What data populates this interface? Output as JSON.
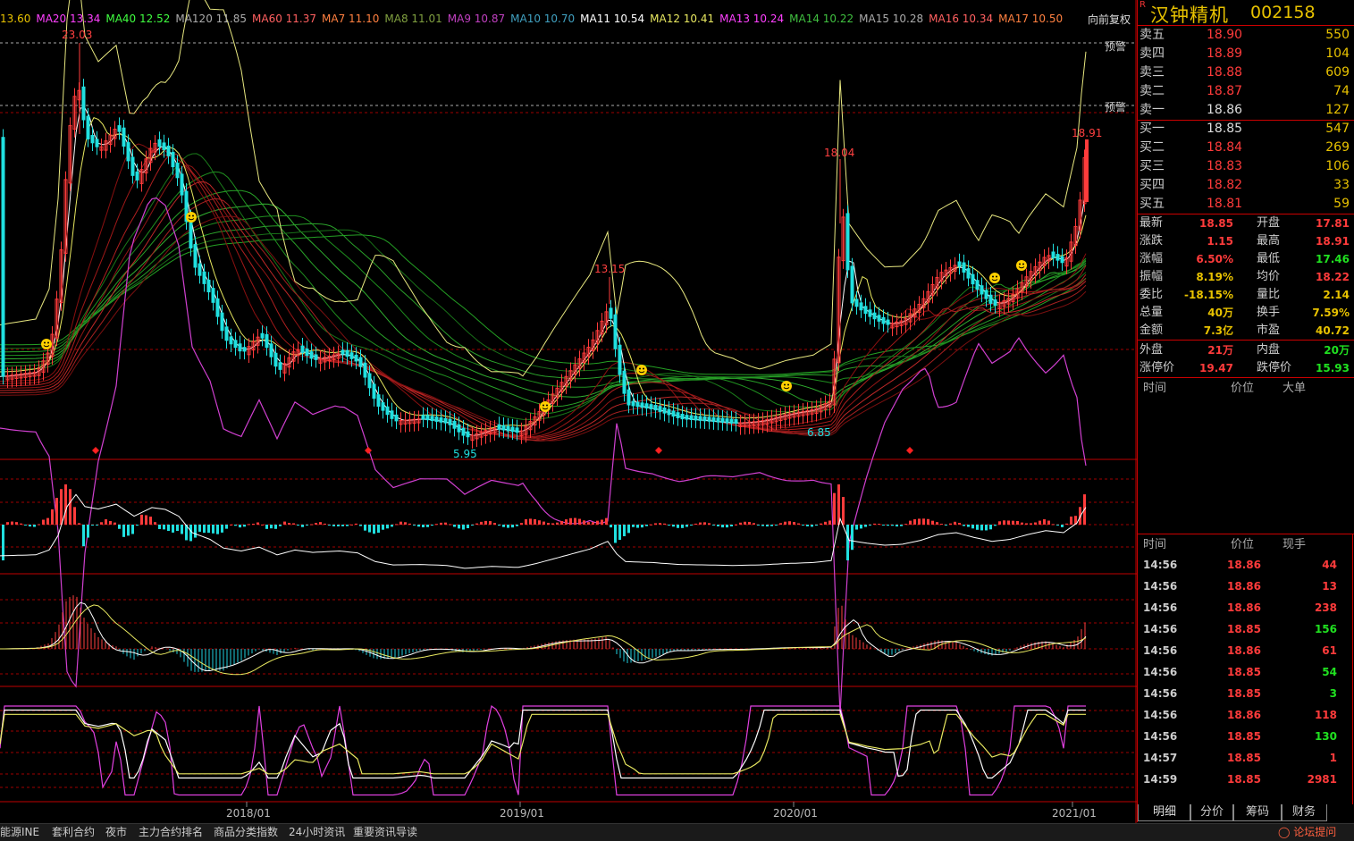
{
  "ma_legend": [
    {
      "label": "",
      "value": "13.60",
      "color": "#e8c200"
    },
    {
      "label": "MA20",
      "value": "13.34",
      "color": "#ff40ff"
    },
    {
      "label": "MA40",
      "value": "12.52",
      "color": "#40ff40"
    },
    {
      "label": "MA120",
      "value": "11.85",
      "color": "#aaaaaa"
    },
    {
      "label": "MA60",
      "value": "11.37",
      "color": "#ff6060"
    },
    {
      "label": "MA7",
      "value": "11.10",
      "color": "#ff8040"
    },
    {
      "label": "MA8",
      "value": "11.01",
      "color": "#80a040"
    },
    {
      "label": "MA9",
      "value": "10.87",
      "color": "#c040c0"
    },
    {
      "label": "MA10",
      "value": "10.70",
      "color": "#40a0c0"
    },
    {
      "label": "MA11",
      "value": "10.54",
      "color": "#ffffff"
    },
    {
      "label": "MA12",
      "value": "10.41",
      "color": "#e8e860"
    },
    {
      "label": "MA13",
      "value": "10.24",
      "color": "#ff40ff"
    },
    {
      "label": "MA14",
      "value": "10.22",
      "color": "#40c040"
    },
    {
      "label": "MA15",
      "value": "10.28",
      "color": "#aaaaaa"
    },
    {
      "label": "MA16",
      "value": "10.34",
      "color": "#ff6060"
    },
    {
      "label": "MA17",
      "value": "10.50",
      "color": "#ff8040"
    }
  ],
  "adjust_button": "向前复权",
  "warn_label": "预警",
  "price_annotations": {
    "high_2017": "23.03",
    "high_2019": "13.15",
    "high_2020": "18.04",
    "high_2021": "18.91",
    "low_2018": "5.95",
    "low_2020": "6.85"
  },
  "x_axis_labels": [
    "2018/01",
    "2019/01",
    "2020/01",
    "2021/01"
  ],
  "stock": {
    "name": "汉钟精机",
    "code": "002158",
    "r_mark": "R"
  },
  "asks": [
    {
      "label": "卖五",
      "price": "18.90",
      "vol": "550"
    },
    {
      "label": "卖四",
      "price": "18.89",
      "vol": "104"
    },
    {
      "label": "卖三",
      "price": "18.88",
      "vol": "609"
    },
    {
      "label": "卖二",
      "price": "18.87",
      "vol": "74"
    },
    {
      "label": "卖一",
      "price": "18.86",
      "vol": "127"
    }
  ],
  "bids": [
    {
      "label": "买一",
      "price": "18.85",
      "vol": "547"
    },
    {
      "label": "买二",
      "price": "18.84",
      "vol": "269"
    },
    {
      "label": "买三",
      "price": "18.83",
      "vol": "106"
    },
    {
      "label": "买四",
      "price": "18.82",
      "vol": "33"
    },
    {
      "label": "买五",
      "price": "18.81",
      "vol": "59"
    }
  ],
  "stats": [
    {
      "l1": "最新",
      "v1": "18.85",
      "c1": "#ff3b3b",
      "l2": "开盘",
      "v2": "17.81",
      "c2": "#ff3b3b"
    },
    {
      "l1": "涨跌",
      "v1": "1.15",
      "c1": "#ff3b3b",
      "l2": "最高",
      "v2": "18.91",
      "c2": "#ff3b3b"
    },
    {
      "l1": "涨幅",
      "v1": "6.50%",
      "c1": "#ff3b3b",
      "l2": "最低",
      "v2": "17.46",
      "c2": "#20e020"
    },
    {
      "l1": "振幅",
      "v1": "8.19%",
      "c1": "#e8c200",
      "l2": "均价",
      "v2": "18.22",
      "c2": "#ff3b3b"
    },
    {
      "l1": "委比",
      "v1": "-18.15%",
      "c1": "#e8c200",
      "l2": "量比",
      "v2": "2.14",
      "c2": "#e8c200"
    },
    {
      "l1": "总量",
      "v1": "40万",
      "c1": "#e8c200",
      "l2": "换手",
      "v2": "7.59%",
      "c2": "#e8c200"
    },
    {
      "l1": "金额",
      "v1": "7.3亿",
      "c1": "#e8c200",
      "l2": "市盈",
      "v2": "40.72",
      "c2": "#e8c200"
    },
    {
      "l1": "外盘",
      "v1": "21万",
      "c1": "#ff3b3b",
      "l2": "内盘",
      "v2": "20万",
      "c2": "#20e020"
    },
    {
      "l1": "涨停价",
      "v1": "19.47",
      "c1": "#ff3b3b",
      "l2": "跌停价",
      "v2": "15.93",
      "c2": "#20e020"
    }
  ],
  "big_order_header": {
    "time": "时间",
    "price": "价位",
    "big": "大单"
  },
  "tick_header": {
    "time": "时间",
    "price": "价位",
    "vol": "现手"
  },
  "ticks": [
    {
      "t": "14:56",
      "p": "18.86",
      "v": "44",
      "c": "#ff3b3b"
    },
    {
      "t": "14:56",
      "p": "18.86",
      "v": "13",
      "c": "#ff3b3b"
    },
    {
      "t": "14:56",
      "p": "18.86",
      "v": "238",
      "c": "#ff3b3b"
    },
    {
      "t": "14:56",
      "p": "18.85",
      "v": "156",
      "c": "#20e020"
    },
    {
      "t": "14:56",
      "p": "18.86",
      "v": "61",
      "c": "#ff3b3b"
    },
    {
      "t": "14:56",
      "p": "18.85",
      "v": "54",
      "c": "#20e020"
    },
    {
      "t": "14:56",
      "p": "18.85",
      "v": "3",
      "c": "#20e020"
    },
    {
      "t": "14:56",
      "p": "18.86",
      "v": "118",
      "c": "#ff3b3b"
    },
    {
      "t": "14:56",
      "p": "18.85",
      "v": "130",
      "c": "#20e020"
    },
    {
      "t": "14:57",
      "p": "18.85",
      "v": "1",
      "c": "#ff3b3b"
    },
    {
      "t": "14:59",
      "p": "18.85",
      "v": "2981",
      "c": "#ff3b3b"
    }
  ],
  "tabs": [
    "明细",
    "分价",
    "筹码",
    "财务"
  ],
  "bottom_links": [
    "能源INE",
    "套利合约",
    "夜市",
    "主力合约排名",
    "商品分类指数",
    "24小时资讯",
    "重要资讯导读"
  ],
  "forum_link": "论坛提问",
  "colors": {
    "up": "#ff3b3b",
    "down": "#20e0e0",
    "panel_border": "#c00000"
  }
}
